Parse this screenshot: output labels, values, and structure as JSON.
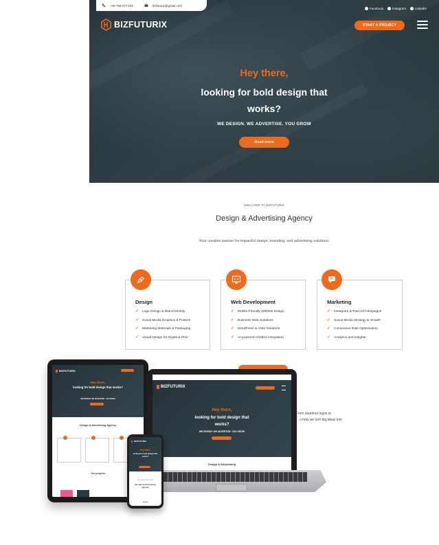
{
  "topbar": {
    "phone": "+40 758 077 624",
    "email": "bizfuturix@gmail.com"
  },
  "social": [
    {
      "label": "Facebook",
      "icon": "facebook-icon"
    },
    {
      "label": "Instagram",
      "icon": "instagram-icon"
    },
    {
      "label": "LinkedIn",
      "icon": "linkedin-icon"
    }
  ],
  "header": {
    "logo": "BIZFUTURIX",
    "cta": "START A PROJECT"
  },
  "hero": {
    "hey": "Hey there,",
    "title": "looking for bold design that works?",
    "subtitle": "WE DESIGN. WE ADVERTISE. YOU GROW",
    "button": "Read more"
  },
  "intro": {
    "eyebrow": "WELCOME TO BIZFUTURIX",
    "title": "Design & Advertising Agency",
    "description": "Your creative partner for impactful design, branding, and advertising solutions."
  },
  "services": [
    {
      "title": "Design",
      "icon": "pen-tool-icon",
      "items": [
        "Logo Design & Brand Identity",
        "Social Media Graphics & Posters",
        "Marketing Materials & Packaging",
        "Visual Design for Digital & Print"
      ]
    },
    {
      "title": "Web Development",
      "icon": "web-monitor-icon",
      "items": [
        "Mobile-Friendly Website Design",
        "Business Web Solutions",
        "WordPress & CMS Solutions",
        "AI-powered Chatbot Integration"
      ]
    },
    {
      "title": "Marketing",
      "icon": "megaphone-icon",
      "items": [
        "Instagram & Paid Ad Campaigns",
        "Social Media Strategy & Growth",
        "Conversion Rate Optimization",
        "Analytics and Insights"
      ]
    }
  ],
  "behind": {
    "line1": "nds. From standout logos to",
    "line2": "n how we turn big ideas into"
  },
  "mockup": {
    "logo": "BIZFUTURIX",
    "hey": "Hey there,",
    "title": "looking for bold design that works?",
    "subtitle": "WE DESIGN. WE ADVERTISE. YOU GROW",
    "section": "Design & Advertising",
    "section_full": "Design & Advertising Agency",
    "projects": "Our projects",
    "phone_eyebrow": "WELCOME TO BIZFUTURIX",
    "phone_extra": "Design"
  },
  "colors": {
    "accent": "#f06a1c",
    "hero_bg": "#2a393f"
  }
}
